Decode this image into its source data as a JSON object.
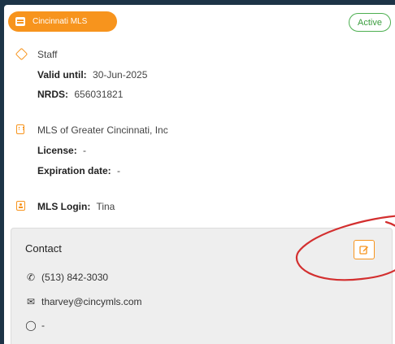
{
  "header": {
    "mls_pill_label": "Cincinnati MLS",
    "status_badge": "Active"
  },
  "membership": {
    "role": "Staff",
    "valid_until_label": "Valid until:",
    "valid_until_value": "30-Jun-2025",
    "nrds_label": "NRDS:",
    "nrds_value": "656031821"
  },
  "organization": {
    "name": "MLS of Greater Cincinnati, Inc",
    "license_label": "License:",
    "license_value": "-",
    "expiration_label": "Expiration date:",
    "expiration_value": "-"
  },
  "login": {
    "label": "MLS Login:",
    "value": "Tina"
  },
  "contact": {
    "title": "Contact",
    "phone": "(513) 842-3030",
    "email": "tharvey@cincymls.com",
    "website": "-"
  },
  "icons": {
    "pill": "list-icon",
    "role": "tag-icon",
    "org": "building-icon",
    "login": "id-card-icon",
    "phone": "phone-icon",
    "email": "mail-icon",
    "website": "globe-icon",
    "edit": "edit-icon"
  },
  "colors": {
    "accent": "#f7941d",
    "active": "#4caf50",
    "annotation": "#d32f2f",
    "background": "#1d3447"
  }
}
